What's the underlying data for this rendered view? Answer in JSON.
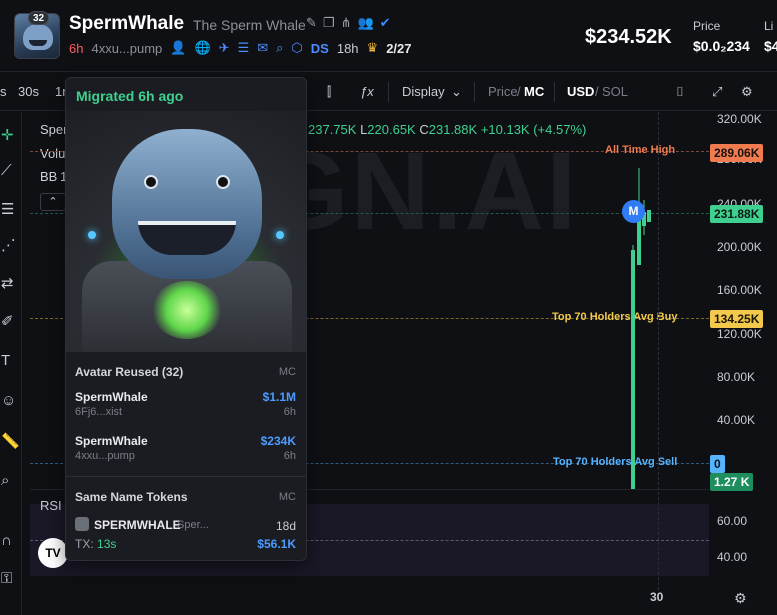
{
  "token": {
    "badge": "32",
    "name": "SpermWhale",
    "fullname": "The Sperm Whale",
    "age": "6h",
    "address": "4xxu...pump",
    "ds_label": "DS",
    "ds_time": "18h",
    "holders": "2/27"
  },
  "market": {
    "mcap": "$234.52K",
    "price_label": "Price",
    "price_value": "$0.0₂234",
    "liq_label": "Li",
    "liq_value": "$4"
  },
  "toolbar": {
    "tf_s": "s",
    "tf_30s": "30s",
    "tf_1m": "1m",
    "display": "Display",
    "price_label": "Price",
    "sep1": "/",
    "mc_label": "MC",
    "usd_label": "USD",
    "sep2": "/",
    "sol_label": "SOL"
  },
  "chart": {
    "series_label": "Sper",
    "volume_label": "Volu",
    "bb_label": "BB",
    "bb_value": "1",
    "ohlc_h": "237.75K",
    "ohlc_l": "220.65K",
    "ohlc_c": "231.88K",
    "ohlc_change": "+10.13K (+4.57%)",
    "watermark": "GN.AI",
    "marker": "M",
    "ath_label": "All Time High",
    "ath_value": "289.06K",
    "current_value": "231.88K",
    "avg_buy_label": "Top 70 Holders Avg Buy",
    "avg_buy_value": "134.25K",
    "avg_sell_label": "Top 70 Holders Avg Sell",
    "avg_sell_value": "0",
    "volume_value": "1.27 K",
    "y_ticks": [
      "320.00K",
      "280.00K",
      "240.00K",
      "200.00K",
      "160.00K",
      "120.00K",
      "80.00K",
      "40.00K"
    ],
    "rsi_label": "RSI",
    "rsi_ticks": [
      "60.00",
      "40.00"
    ],
    "x_label": "30",
    "tv_logo": "TV"
  },
  "popup": {
    "migrated": "Migrated 6h ago",
    "avatar_reused_title": "Avatar Reused (32)",
    "mc_header": "MC",
    "items": [
      {
        "name": "SpermWhale",
        "sub": "6Fj6...xist",
        "mc": "$1.1M",
        "time": "6h"
      },
      {
        "name": "SpermWhale",
        "sub": "4xxu...pump",
        "mc": "$234K",
        "time": "6h"
      }
    ],
    "same_name_title": "Same Name Tokens",
    "same_name_mc_header": "MC",
    "same_name": {
      "name": "SPERMWHALE",
      "sub": "Sper...",
      "time": "18d",
      "tx_label": "TX:",
      "tx_value": "13s",
      "mc": "$56.1K"
    }
  },
  "colors": {
    "accent_green": "#3fd08f",
    "ath_orange": "#f07b4f",
    "avg_buy_yellow": "#f2c94c",
    "avg_sell_blue": "#56b4ff",
    "marker_blue": "#2f7cf6"
  }
}
